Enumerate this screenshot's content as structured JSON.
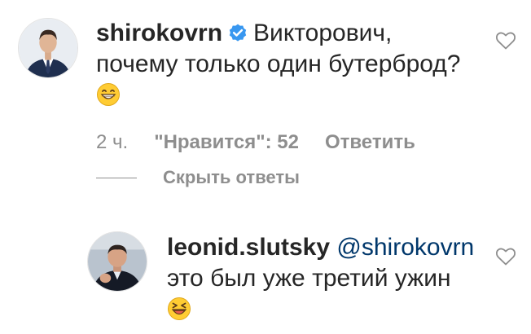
{
  "comment": {
    "username": "shirokovrn",
    "verified": true,
    "text_line1": "Викторович,",
    "text_line2": "почему только один бутерброд?",
    "emoji": "grinning-face-emoji",
    "time": "2 ч.",
    "likes": "\"Нравится\": 52",
    "reply_label": "Ответить",
    "hide_replies_label": "Скрыть ответы"
  },
  "reply": {
    "username": "leonid.slutsky",
    "mention": "@shirokovrn",
    "text": "это был уже третий ужин",
    "emoji": "laughing-face-emoji"
  },
  "colors": {
    "text": "#262626",
    "secondary": "#8e8e8e",
    "mention": "#00376b",
    "verified": "#3897f0"
  }
}
